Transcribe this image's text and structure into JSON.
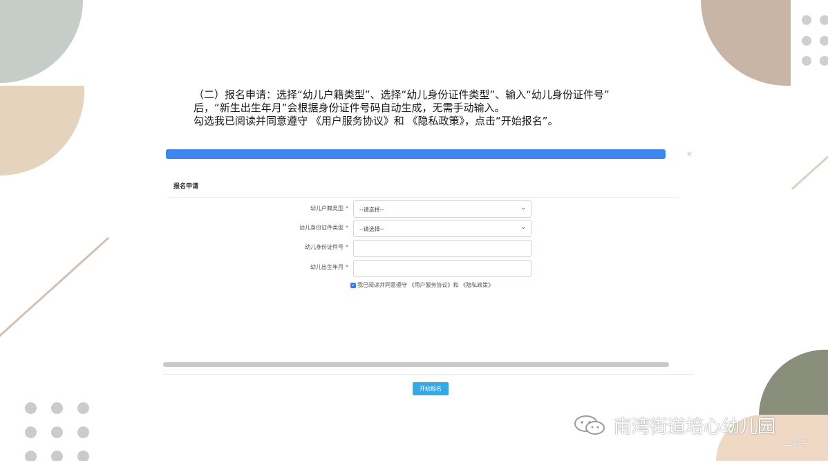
{
  "instructions": {
    "line1": "（二）报名申请：选择“幼儿户籍类型”、选择“幼儿身份证件类型”、输入“幼儿身份证件号”",
    "line2": "后，“新生出生年月”会根据身份证件号码自动生成，无需手动输入。",
    "line3": "勾选我已阅读并同意遵守 《用户服务协议》和 《隐私政策》，点击“开始报名”。"
  },
  "window": {
    "close_icon": "×"
  },
  "form": {
    "section_title": "报名申请",
    "fields": [
      {
        "label": "幼儿户籍类型",
        "required_mark": "*",
        "type": "select",
        "value": "--请选择--"
      },
      {
        "label": "幼儿身份证件类型",
        "required_mark": "*",
        "type": "select",
        "value": "--请选择--"
      },
      {
        "label": "幼儿身份证件号",
        "required_mark": "*",
        "type": "input",
        "value": ""
      },
      {
        "label": "幼儿出生年月",
        "required_mark": "*",
        "type": "input",
        "value": ""
      }
    ],
    "agreement": {
      "checked": true,
      "text": "我已阅读并同意遵守 《用户服务协议》和 《隐私政策》"
    },
    "submit_label": "开始报名"
  },
  "watermark": {
    "title": "南湾街道培心幼儿园",
    "sub": "上卿学"
  },
  "colors": {
    "progress": "#3d86f0",
    "button": "#35a9e6",
    "required": "#e23c3c"
  }
}
